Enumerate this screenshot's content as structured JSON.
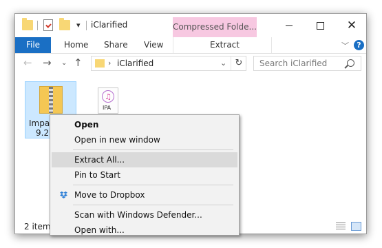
{
  "window": {
    "title": "iClarified",
    "compressed_tab": "Compressed Folde...",
    "qa_dropdown_glyph": "▾",
    "title_separator": "|"
  },
  "ribbon": {
    "tabs": [
      "File",
      "Home",
      "Share",
      "View",
      "Extract"
    ],
    "accent_color": "#1a6fc4",
    "compressed_color": "#f7c8e1"
  },
  "nav": {
    "address": "iClarified",
    "search_placeholder": "Search iClarified"
  },
  "items": [
    {
      "name_line1": "Impac",
      "name_line2": "9.27",
      "type": "zip-folder",
      "selected": true
    },
    {
      "name": "IPA",
      "type": "ipa-file"
    }
  ],
  "status": {
    "count": "2 items"
  },
  "context_menu": {
    "items": [
      {
        "label": "Open",
        "bold": true
      },
      {
        "label": "Open in new window"
      },
      {
        "label": "Extract All...",
        "highlighted": true
      },
      {
        "label": "Pin to Start"
      },
      {
        "label": "Move to Dropbox",
        "icon": "dropbox-icon"
      },
      {
        "label": "Scan with Windows Defender..."
      },
      {
        "label": "Open with..."
      }
    ]
  }
}
